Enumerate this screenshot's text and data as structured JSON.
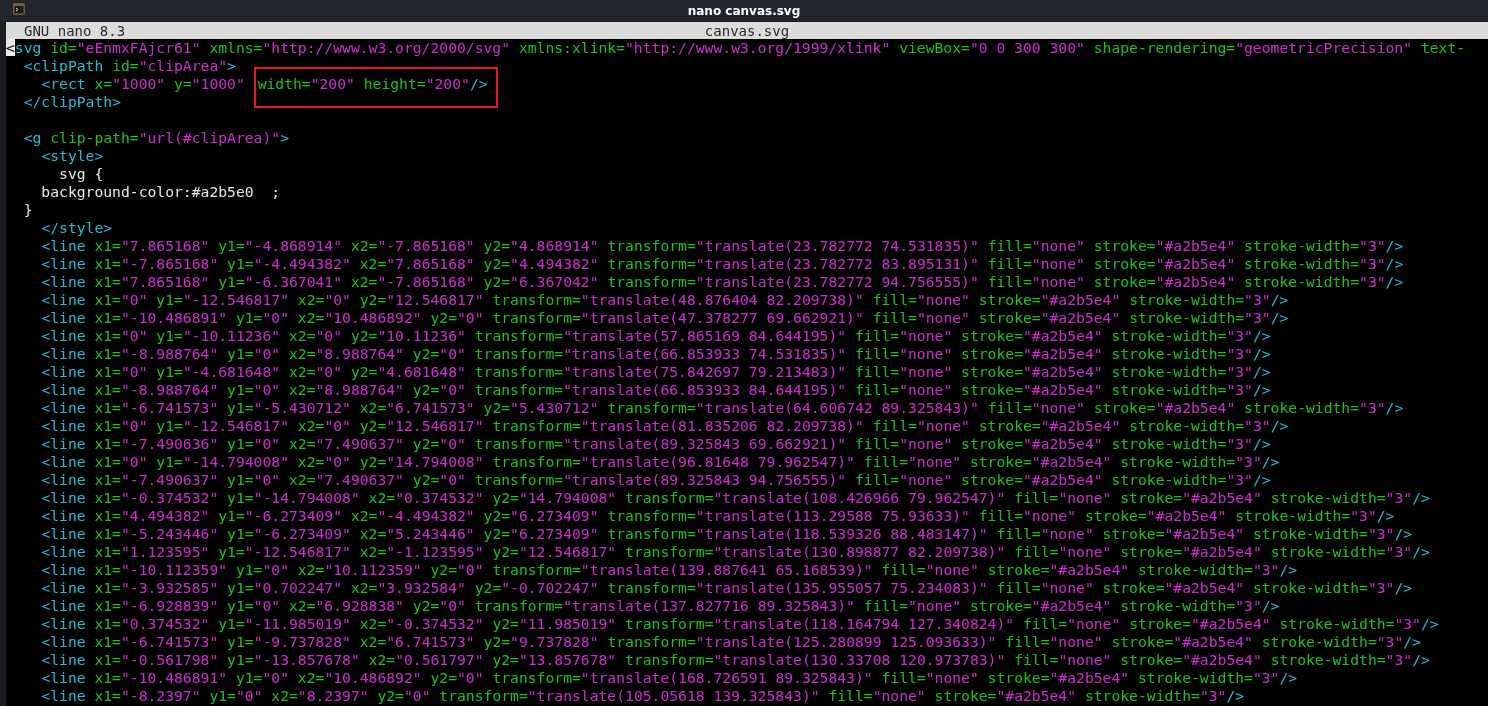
{
  "window": {
    "title": "nano canvas.svg"
  },
  "header": {
    "program": "GNU nano 8.3",
    "file": "canvas.svg"
  },
  "lines": [
    {
      "text": "<svg id=\"eEnmxFAjcr61\" xmlns=\"http://www.w3.org/2000/svg\" xmlns:xlink=\"http://www.w3.org/1999/xlink\" viewBox=\"0 0 300 300\" shape-rendering=\"geometricPrecision\" text-",
      "cursor": true
    },
    {
      "text": "  <clipPath id=\"clipArea\">",
      "cursor": false
    },
    {
      "text": "    <rect x=\"1000\" y=\"1000\" ",
      "boxed": "width=\"200\" height=\"200\"/>",
      "cursor": false
    },
    {
      "text": "  </clipPath>",
      "cursor": false
    },
    {
      "cursor": false
    },
    {
      "text": "  <g clip-path=\"url(#clipArea)\">",
      "cursor": false
    },
    {
      "text": "    <style>",
      "cursor": false
    },
    {
      "text": "      svg {",
      "cursor": false
    },
    {
      "text": "    background-color:#a2b5e0  ;",
      "cursor": false
    },
    {
      "text": "  }",
      "cursor": false
    },
    {
      "text": "    </style>",
      "cursor": false
    },
    {
      "text": "    <line x1=\"7.865168\" y1=\"-4.868914\" x2=\"-7.865168\" y2=\"4.868914\" transform=\"translate(23.782772 74.531835)\" fill=\"none\" stroke=\"#a2b5e4\" stroke-width=\"3\"/>",
      "cursor": false
    },
    {
      "text": "    <line x1=\"-7.865168\" y1=\"-4.494382\" x2=\"7.865168\" y2=\"4.494382\" transform=\"translate(23.782772 83.895131)\" fill=\"none\" stroke=\"#a2b5e4\" stroke-width=\"3\"/>",
      "cursor": false
    },
    {
      "text": "    <line x1=\"7.865168\" y1=\"-6.367041\" x2=\"-7.865168\" y2=\"6.367042\" transform=\"translate(23.782772 94.756555)\" fill=\"none\" stroke=\"#a2b5e4\" stroke-width=\"3\"/>",
      "cursor": false
    },
    {
      "text": "    <line x1=\"0\" y1=\"-12.546817\" x2=\"0\" y2=\"12.546817\" transform=\"translate(48.876404 82.209738)\" fill=\"none\" stroke=\"#a2b5e4\" stroke-width=\"3\"/>",
      "cursor": false
    },
    {
      "text": "    <line x1=\"-10.486891\" y1=\"0\" x2=\"10.486892\" y2=\"0\" transform=\"translate(47.378277 69.662921)\" fill=\"none\" stroke=\"#a2b5e4\" stroke-width=\"3\"/>",
      "cursor": false
    },
    {
      "text": "    <line x1=\"0\" y1=\"-10.11236\" x2=\"0\" y2=\"10.11236\" transform=\"translate(57.865169 84.644195)\" fill=\"none\" stroke=\"#a2b5e4\" stroke-width=\"3\"/>",
      "cursor": false
    },
    {
      "text": "    <line x1=\"-8.988764\" y1=\"0\" x2=\"8.988764\" y2=\"0\" transform=\"translate(66.853933 74.531835)\" fill=\"none\" stroke=\"#a2b5e4\" stroke-width=\"3\"/>",
      "cursor": false
    },
    {
      "text": "    <line x1=\"0\" y1=\"-4.681648\" x2=\"0\" y2=\"4.681648\" transform=\"translate(75.842697 79.213483)\" fill=\"none\" stroke=\"#a2b5e4\" stroke-width=\"3\"/>",
      "cursor": false
    },
    {
      "text": "    <line x1=\"-8.988764\" y1=\"0\" x2=\"8.988764\" y2=\"0\" transform=\"translate(66.853933 84.644195)\" fill=\"none\" stroke=\"#a2b5e4\" stroke-width=\"3\"/>",
      "cursor": false
    },
    {
      "text": "    <line x1=\"-6.741573\" y1=\"-5.430712\" x2=\"6.741573\" y2=\"5.430712\" transform=\"translate(64.606742 89.325843)\" fill=\"none\" stroke=\"#a2b5e4\" stroke-width=\"3\"/>",
      "cursor": false
    },
    {
      "text": "    <line x1=\"0\" y1=\"-12.546817\" x2=\"0\" y2=\"12.546817\" transform=\"translate(81.835206 82.209738)\" fill=\"none\" stroke=\"#a2b5e4\" stroke-width=\"3\"/>",
      "cursor": false
    },
    {
      "text": "    <line x1=\"-7.490636\" y1=\"0\" x2=\"7.490637\" y2=\"0\" transform=\"translate(89.325843 69.662921)\" fill=\"none\" stroke=\"#a2b5e4\" stroke-width=\"3\"/>",
      "cursor": false
    },
    {
      "text": "    <line x1=\"0\" y1=\"-14.794008\" x2=\"0\" y2=\"14.794008\" transform=\"translate(96.81648 79.962547)\" fill=\"none\" stroke=\"#a2b5e4\" stroke-width=\"3\"/>",
      "cursor": false
    },
    {
      "text": "    <line x1=\"-7.490637\" y1=\"0\" x2=\"7.490637\" y2=\"0\" transform=\"translate(89.325843 94.756555)\" fill=\"none\" stroke=\"#a2b5e4\" stroke-width=\"3\"/>",
      "cursor": false
    },
    {
      "text": "    <line x1=\"-0.374532\" y1=\"-14.794008\" x2=\"0.374532\" y2=\"14.794008\" transform=\"translate(108.426966 79.962547)\" fill=\"none\" stroke=\"#a2b5e4\" stroke-width=\"3\"/>",
      "cursor": false
    },
    {
      "text": "    <line x1=\"4.494382\" y1=\"-6.273409\" x2=\"-4.494382\" y2=\"6.273409\" transform=\"translate(113.29588 75.93633)\" fill=\"none\" stroke=\"#a2b5e4\" stroke-width=\"3\"/>",
      "cursor": false
    },
    {
      "text": "    <line x1=\"-5.243446\" y1=\"-6.273409\" x2=\"5.243446\" y2=\"6.273409\" transform=\"translate(118.539326 88.483147)\" fill=\"none\" stroke=\"#a2b5e4\" stroke-width=\"3\"/>",
      "cursor": false
    },
    {
      "text": "    <line x1=\"1.123595\" y1=\"-12.546817\" x2=\"-1.123595\" y2=\"12.546817\" transform=\"translate(130.898877 82.209738)\" fill=\"none\" stroke=\"#a2b5e4\" stroke-width=\"3\"/>",
      "cursor": false
    },
    {
      "text": "    <line x1=\"-10.112359\" y1=\"0\" x2=\"10.112359\" y2=\"0\" transform=\"translate(139.887641 65.168539)\" fill=\"none\" stroke=\"#a2b5e4\" stroke-width=\"3\"/>",
      "cursor": false
    },
    {
      "text": "    <line x1=\"-3.932585\" y1=\"0.702247\" x2=\"3.932584\" y2=\"-0.702247\" transform=\"translate(135.955057 75.234083)\" fill=\"none\" stroke=\"#a2b5e4\" stroke-width=\"3\"/>",
      "cursor": false
    },
    {
      "text": "    <line x1=\"-6.928839\" y1=\"0\" x2=\"6.928838\" y2=\"0\" transform=\"translate(137.827716 89.325843)\" fill=\"none\" stroke=\"#a2b5e4\" stroke-width=\"3\"/>",
      "cursor": false
    },
    {
      "text": "    <line x1=\"0.374532\" y1=\"-11.985019\" x2=\"-0.374532\" y2=\"11.985019\" transform=\"translate(118.164794 127.340824)\" fill=\"none\" stroke=\"#a2b5e4\" stroke-width=\"3\"/>",
      "cursor": false
    },
    {
      "text": "    <line x1=\"-6.741573\" y1=\"-9.737828\" x2=\"6.741573\" y2=\"9.737828\" transform=\"translate(125.280899 125.093633)\" fill=\"none\" stroke=\"#a2b5e4\" stroke-width=\"3\"/>",
      "cursor": false
    },
    {
      "text": "    <line x1=\"-0.561798\" y1=\"-13.857678\" x2=\"0.561797\" y2=\"13.857678\" transform=\"translate(130.33708 120.973783)\" fill=\"none\" stroke=\"#a2b5e4\" stroke-width=\"3\"/>",
      "cursor": false
    },
    {
      "text": "    <line x1=\"-10.486891\" y1=\"0\" x2=\"10.486892\" y2=\"0\" transform=\"translate(168.726591 89.325843)\" fill=\"none\" stroke=\"#a2b5e4\" stroke-width=\"3\"/>",
      "cursor": false
    },
    {
      "text": "    <line x1=\"-8.2397\" y1=\"0\" x2=\"8.2397\" y2=\"0\" transform=\"translate(105.05618 139.325843)\" fill=\"none\" stroke=\"#a2b5e4\" stroke-width=\"3\"/>",
      "cursor": false
    }
  ]
}
